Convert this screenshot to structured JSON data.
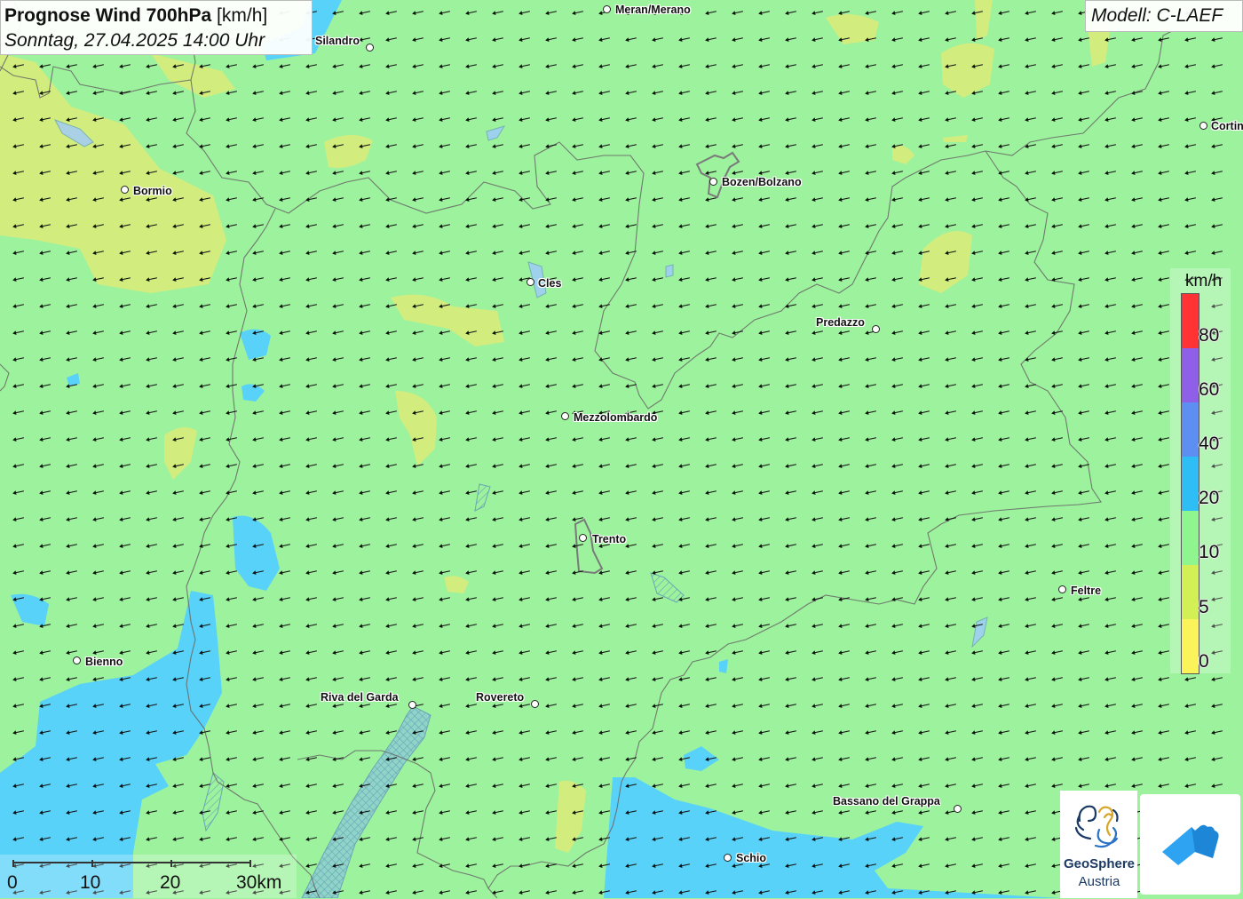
{
  "title": {
    "bold": "Prognose Wind 700hPa",
    "unit": "[km/h]",
    "date": "Sonntag, 27.04.2025 14:00 Uhr"
  },
  "model": "Modell: C-LAEF",
  "places": [
    {
      "name": "Meran/Merano"
    },
    {
      "name": "Silandro"
    },
    {
      "name": "Cortina"
    },
    {
      "name": "Bormio"
    },
    {
      "name": "Bozen/Bolzano"
    },
    {
      "name": "Cles"
    },
    {
      "name": "Predazzo"
    },
    {
      "name": "Mezzolombardo"
    },
    {
      "name": "Trento"
    },
    {
      "name": "Feltre"
    },
    {
      "name": "Bienno"
    },
    {
      "name": "Riva del Garda"
    },
    {
      "name": "Rovereto"
    },
    {
      "name": "Bassano del Grappa"
    },
    {
      "name": "Schio"
    }
  ],
  "legend": {
    "unit": "km/h",
    "labels": [
      "80",
      "60",
      "40",
      "20",
      "10",
      "5",
      "0"
    ],
    "colors": [
      "#ff3333",
      "#8f5fe8",
      "#5d8ef2",
      "#2fbdf6",
      "#8ff58f",
      "#d2ef55",
      "#fbf35a"
    ]
  },
  "scale": {
    "labels": [
      "0",
      "10",
      "20",
      "30km"
    ]
  },
  "logos": {
    "geosphere_line1": "GeoSphere",
    "geosphere_line2": "Austria",
    "app_icon": "weather-app-logo-icon"
  },
  "colors": {
    "calm_green": "#9df29d",
    "light_blue": "#58d2f8",
    "yellow_green": "#d5ec7c",
    "arrow": "#111111"
  },
  "wind": {
    "direction": "east-south-east wind, arrows pointing west-north-west"
  }
}
